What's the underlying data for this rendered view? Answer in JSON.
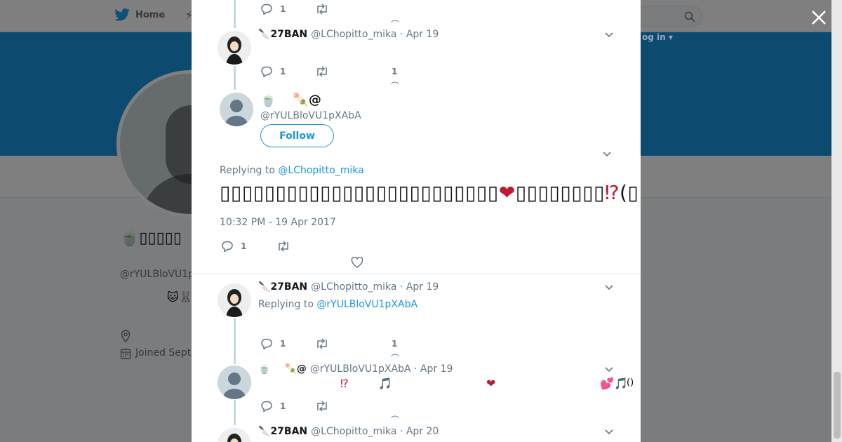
{
  "background": {
    "nav_home": "Home",
    "login_label": "og in ▾",
    "profile_name": "🍵▯▯▯▯▯",
    "profile_handle": "@rYULBloVU1p",
    "bio_emoji": "🐱🐰",
    "joined": "Joined Septe"
  },
  "thread": {
    "top_reply_count": "1",
    "tweet1": {
      "emoji": "🔪",
      "name": "27BAN",
      "handle": "@LChopitto_mika",
      "date": "· Apr 19",
      "reply_count": "1",
      "like_count": "1"
    },
    "main": {
      "name_emoji": "🍵",
      "name_emoji2": "🍡",
      "name_at": "@",
      "handle": "@rYULBloVU1pXAbA",
      "follow_label": "Follow",
      "replying_label": "Replying to ",
      "replying_handle": "@LChopitto_mika",
      "text_part1": "▯▯▯▯▯▯▯▯▯▯▯▯▯▯▯▯▯▯▯▯▯▯▯▯▯",
      "text_heart": "❤",
      "text_part2": "▯▯▯▯▯▯▯▯",
      "text_interrobang": "⁉",
      "text_end": "(▯)",
      "timestamp": "10:32 PM - 19 Apr 2017",
      "reply_count": "1"
    },
    "tweet2": {
      "emoji": "🔪",
      "name": "27BAN",
      "handle": "@LChopitto_mika",
      "date": "· Apr 19",
      "replying_label": "Replying to ",
      "replying_handle": "@rYULBloVU1pXAbA",
      "reply_count": "1",
      "like_count": "1"
    },
    "tweet3": {
      "emoji": "🍵",
      "emoji2": "🍡",
      "at": "@",
      "handle": "@rYULBloVU1pXAbA",
      "date": "· Apr 19",
      "e1": "⁉",
      "e2": "🎵",
      "e3": "❤",
      "e4": "💕",
      "e5": "🎵",
      "e6": "()",
      "reply_count": "1"
    },
    "tweet4": {
      "emoji": "🔪",
      "name": "27BAN",
      "handle": "@LChopitto_mika",
      "date": "· Apr 20"
    }
  },
  "colors": {
    "accent": "#1b95e0",
    "banner": "#1b95e0",
    "heart": "#be1931"
  }
}
